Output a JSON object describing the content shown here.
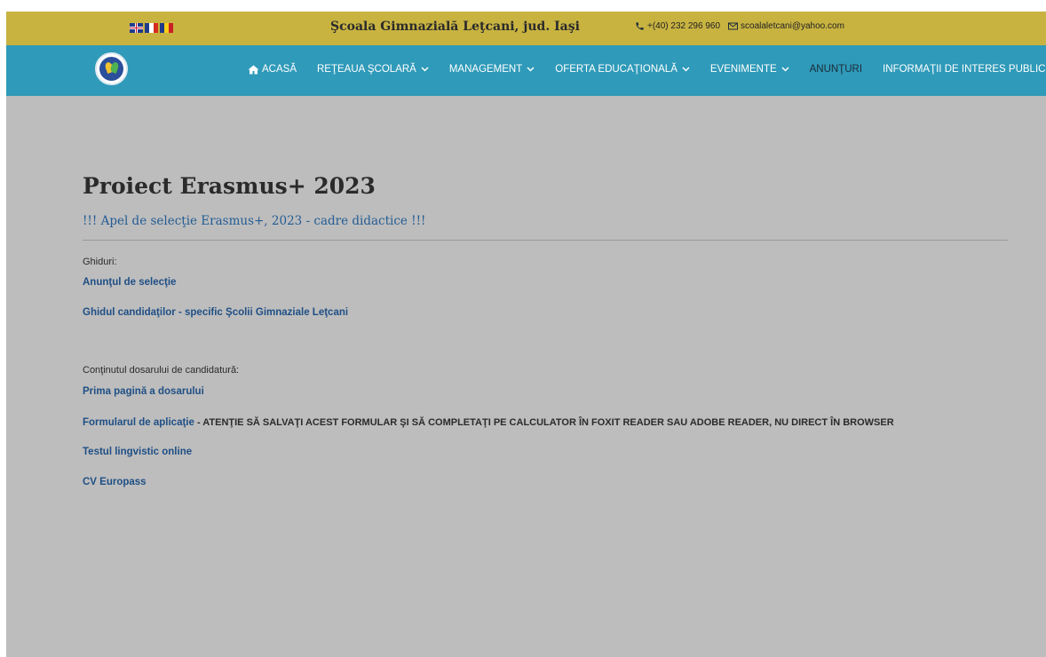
{
  "header": {
    "languages": [
      "English",
      "Français",
      "Română"
    ],
    "school_name": "Şcoala Gimnazială Leţcani, jud. Iaşi",
    "phone": "+(40) 232 296 960",
    "email": "scoalaletcani@yahoo.com"
  },
  "nav": {
    "logo_text": "Şcoala Gimnazială Leţcani",
    "items": [
      {
        "label": "ACASĂ",
        "icon": "home-icon"
      },
      {
        "label": "REŢEAUA ŞCOLARĂ",
        "icon": "chevron-down-icon"
      },
      {
        "label": "MANAGEMENT",
        "icon": "chevron-down-icon"
      },
      {
        "label": "OFERTA EDUCAŢIONALĂ",
        "icon": "chevron-down-icon"
      },
      {
        "label": "EVENIMENTE",
        "icon": "chevron-down-icon"
      },
      {
        "label": "ANUNŢURI",
        "active": true
      },
      {
        "label": "INFORMAŢII DE INTERES PUBLIC"
      }
    ]
  },
  "colors": {
    "topbar": "#c8b341",
    "navbar": "#2f9ab9",
    "background": "#bdbdbd",
    "link": "#1f4f85"
  },
  "content": {
    "title": "Proiect Erasmus+ 2023",
    "subtitle": "!!! Apel de selecţie Erasmus+, 2023 - cadre didactice !!!",
    "guides_label": "Ghiduri:",
    "guides": [
      "Anunţul de selecţie",
      "Ghidul candidaţilor - specific Şcolii Gimnaziale Leţcani"
    ],
    "dossier_label": "Conţinutul dosarului de candidatură:",
    "dossier": {
      "first_page": "Prima pagină a dosarului",
      "form_link": "Formularul de aplicaţie",
      "form_note": " - ATENŢIE SĂ SALVAŢI ACEST FORMULAR ŞI SĂ COMPLETAŢI PE CALCULATOR ÎN  FOXIT READER SAU ADOBE READER, NU DIRECT ÎN BROWSER",
      "test": "Testul lingvistic online",
      "cv": "CV Europass"
    }
  }
}
